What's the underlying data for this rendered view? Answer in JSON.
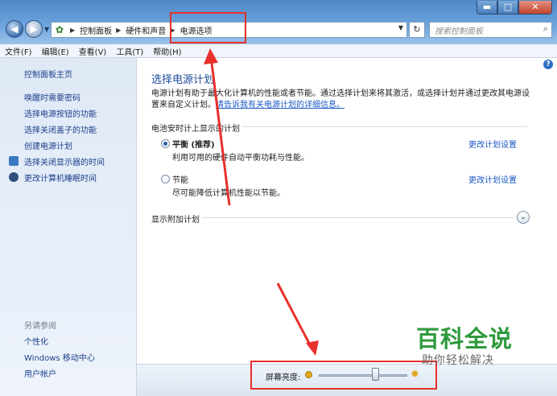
{
  "window": {
    "minimize": "▬",
    "maximize": "□",
    "close": "✕"
  },
  "address_bar": {
    "crumbs": [
      "控制面板",
      "硬件和声音",
      "电源选项"
    ],
    "search_placeholder": "搜索控制面板"
  },
  "menu": [
    "文件(F)",
    "编辑(E)",
    "查看(V)",
    "工具(T)",
    "帮助(H)"
  ],
  "sidebar": {
    "home": "控制面板主页",
    "links": [
      "唤醒时需要密码",
      "选择电源按钮的功能",
      "选择关闭盖子的功能",
      "创建电源计划",
      "选择关闭显示器的时间",
      "更改计算机睡眠时间"
    ],
    "see_also_heading": "另请参阅",
    "see_also": [
      "个性化",
      "Windows 移动中心",
      "用户帐户"
    ]
  },
  "main": {
    "title": "选择电源计划",
    "desc_text": "电源计划有助于最大化计算机的性能或者节能。通过选择计划来将其激活，或选择计划并通过更改其电源设置来自定义计划。",
    "desc_link": "请告诉我有关电源计划的详细信息。",
    "group_label": "电池安时计上显示的计划",
    "plans": [
      {
        "name": "平衡 (推荐)",
        "desc": "利用可用的硬件自动平衡功耗与性能。",
        "link": "更改计划设置",
        "selected": true
      },
      {
        "name": "节能",
        "desc": "尽可能降低计算机性能以节能。",
        "link": "更改计划设置",
        "selected": false
      }
    ],
    "extra_plans_label": "显示附加计划"
  },
  "bottom_bar": {
    "brightness_label": "屏幕亮度:",
    "brightness_level": 0.65
  },
  "watermark": {
    "title": "百科全说",
    "subtitle": "助你轻松解决"
  },
  "colors": {
    "annotation": "#e8302b",
    "link": "#1b58c4",
    "title": "#1e4c9a",
    "watermark": "#2e9a3c"
  }
}
